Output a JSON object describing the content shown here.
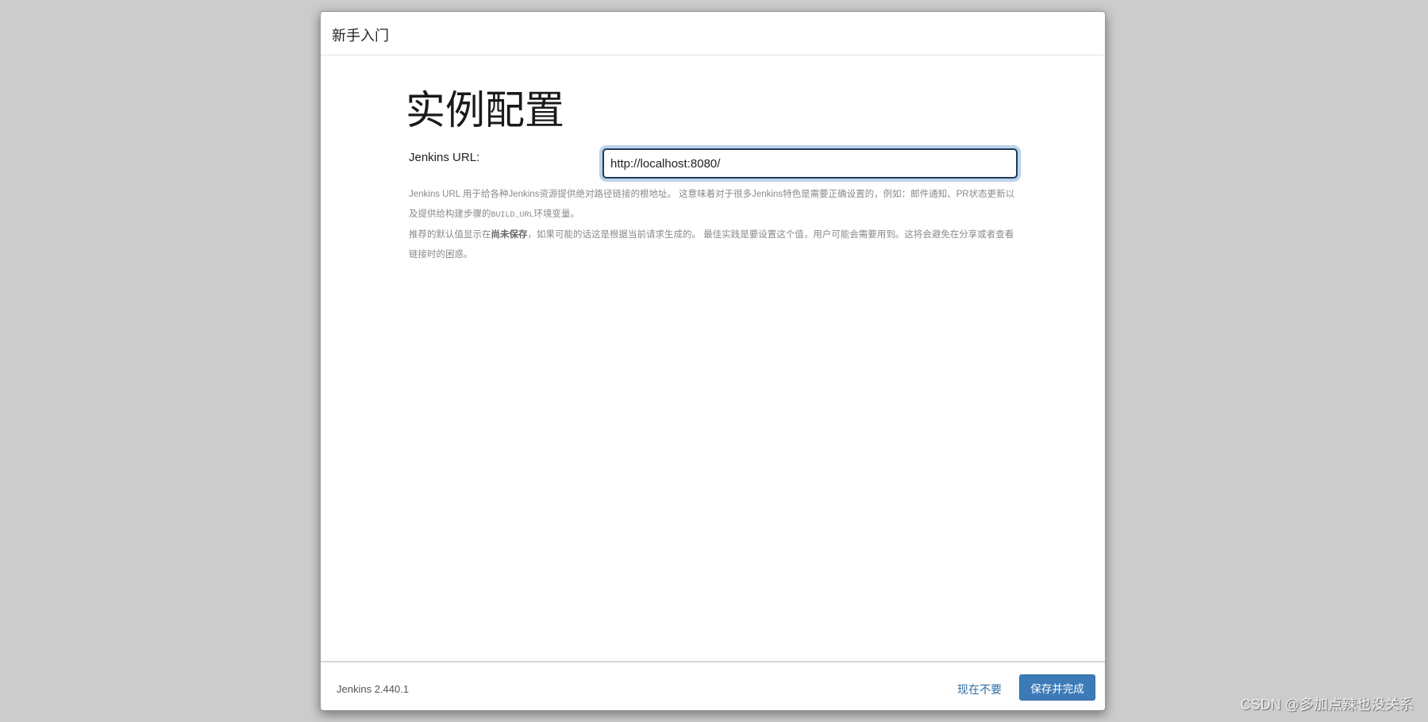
{
  "dialog": {
    "header": "新手入门",
    "title": "实例配置"
  },
  "form": {
    "label": "Jenkins URL:",
    "value": "http://localhost:8080/",
    "help1a": "Jenkins URL 用于给各种Jenkins资源提供绝对路径链接的根地址。 这意味着对于很多Jenkins特色是需要正确设置的，例如：邮件通知、PR状态更新以及提供给构建步骤的",
    "help1code": "BUILD_URL",
    "help1b": "环境变量。",
    "help2a": "推荐的默认值显示在",
    "help2bold": "尚未保存",
    "help2b": "，如果可能的话这是根据当前请求生成的。 最佳实践是要设置这个值，用户可能会需要用到。这将会避免在分享或者查看链接时的困惑。"
  },
  "footer": {
    "version": "Jenkins 2.440.1",
    "skip": "现在不要",
    "save": "保存并完成"
  },
  "watermark": "CSDN @多加点辣也没关系"
}
